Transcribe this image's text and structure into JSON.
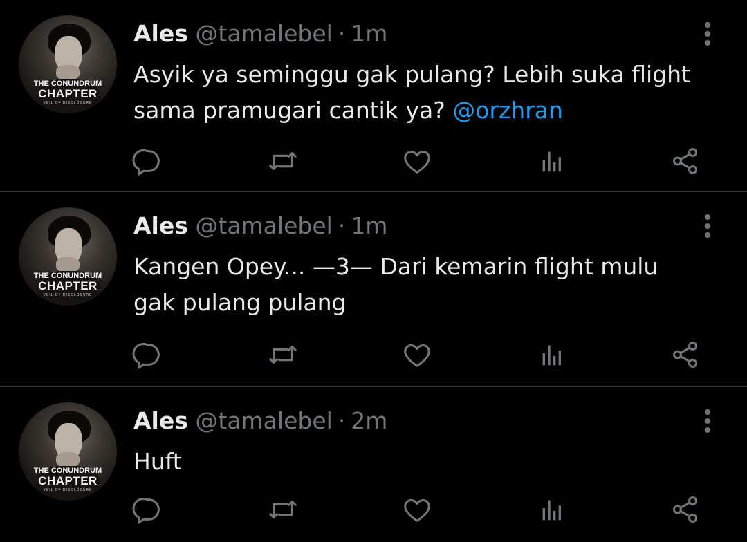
{
  "avatar_text": {
    "line1": "THE CONUNDRUM",
    "line2": "CHAPTER",
    "line3": "VEIL OF DISCLOSURE"
  },
  "tweets": [
    {
      "name": "Ales",
      "handle": "@tamalebel",
      "separator": "·",
      "time": "1m",
      "text": "Asyik ya seminggu gak pulang? Lebih suka flight sama pramugari cantik ya? ",
      "mention": "@orzhran"
    },
    {
      "name": "Ales",
      "handle": "@tamalebel",
      "separator": "·",
      "time": "1m",
      "text": "Kangen Opey... —3— Dari kemarin flight mulu gak pulang pulang",
      "mention": ""
    },
    {
      "name": "Ales",
      "handle": "@tamalebel",
      "separator": "·",
      "time": "2m",
      "text": "Huft",
      "mention": ""
    }
  ],
  "icons": {
    "more": "more-vertical-icon",
    "reply": "reply-icon",
    "retweet": "retweet-icon",
    "like": "heart-icon",
    "views": "views-icon",
    "share": "share-icon"
  },
  "colors": {
    "background": "#000000",
    "text": "#e7e9ea",
    "muted": "#71767b",
    "link": "#1d9bf0",
    "divider": "#2f3336"
  }
}
